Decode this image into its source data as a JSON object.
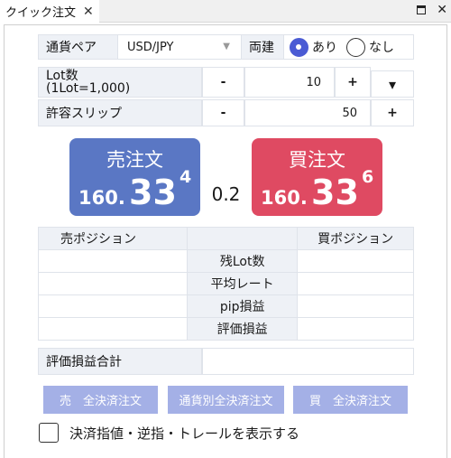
{
  "tab": {
    "title": "クイック注文",
    "close": "✕"
  },
  "window": {
    "maximize": "",
    "close": "✕"
  },
  "pair": {
    "label": "通貨ペア",
    "value": "USD/JPY",
    "arrow": "▼"
  },
  "hedge": {
    "label": "両建",
    "options": [
      "あり",
      "なし"
    ],
    "selected": "あり"
  },
  "lot": {
    "label_line1": "Lot数",
    "label_line2": "(1Lot=1,000)",
    "minus": "-",
    "value": "10",
    "plus": "+",
    "dropdown": "▾"
  },
  "slip": {
    "label": "許容スリップ",
    "minus": "-",
    "value": "50",
    "plus": "+"
  },
  "sell": {
    "label": "売注文",
    "base": "160.",
    "big": "33",
    "sup": "4",
    "color": "#5a77c4"
  },
  "buy": {
    "label": "買注文",
    "base": "160.",
    "big": "33",
    "sup": "6",
    "color": "#df4a62"
  },
  "spread": "0.2",
  "positions": {
    "sell_header": "売ポジション",
    "buy_header": "買ポジション",
    "rows": [
      "残Lot数",
      "平均レート",
      "pip損益",
      "評価損益"
    ]
  },
  "total": {
    "label": "評価損益合計",
    "value": ""
  },
  "buttons": {
    "sell_all": "売　全決済注文",
    "pair_all": "通貨別全決済注文",
    "buy_all": "買　全決済注文"
  },
  "checkbox": {
    "label": "決済指値・逆指・トレールを表示する",
    "checked": false
  }
}
